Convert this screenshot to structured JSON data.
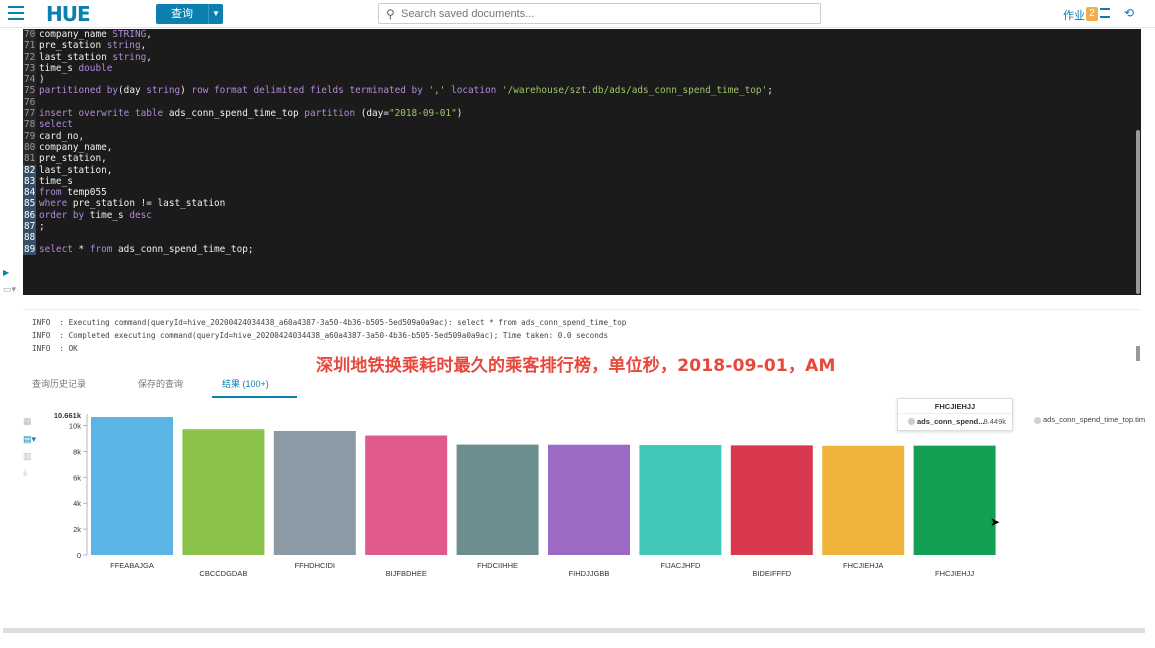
{
  "topbar": {
    "logo": "HUE",
    "query_button": "查询",
    "search_placeholder": "Search saved documents...",
    "jobs_label": "作业",
    "jobs_count": "2"
  },
  "editor": {
    "lines": [
      {
        "n": "70",
        "html": "company_name <span class='ty'>STRING</span>,"
      },
      {
        "n": "71",
        "html": "pre_station <span class='ty'>string</span>,"
      },
      {
        "n": "72",
        "html": "last_station <span class='ty'>string</span>,"
      },
      {
        "n": "73",
        "html": "time_s <span class='ty'>double</span>"
      },
      {
        "n": "74",
        "html": ")"
      },
      {
        "n": "75",
        "html": "<span class='kw'>partitioned by</span>(day <span class='ty'>string</span>) <span class='kw'>row format delimited fields terminated by</span> <span class='str'>','</span> <span class='kw'>location</span> <span class='str'>'/warehouse/szt.db/ads/ads_conn_spend_time_top'</span>;"
      },
      {
        "n": "76",
        "html": ""
      },
      {
        "n": "77",
        "html": "<span class='kw'>insert overwrite table</span> ads_conn_spend_time_top <span class='kw'>partition</span> (day=<span class='str'>\"2018-09-01\"</span>)"
      },
      {
        "n": "78",
        "html": "<span class='kw'>select</span>"
      },
      {
        "n": "79",
        "html": "card_no,"
      },
      {
        "n": "80",
        "html": "company_name,"
      },
      {
        "n": "81",
        "html": "pre_station,"
      },
      {
        "n": "82",
        "html": "last_station,"
      },
      {
        "n": "83",
        "html": "time_s"
      },
      {
        "n": "84",
        "html": "<span class='kw'>from</span> temp055"
      },
      {
        "n": "85",
        "html": "<span class='kw'>where</span> pre_station != last_station"
      },
      {
        "n": "86",
        "html": "<span class='kw'>order by</span> time_s <span class='kw'>desc</span>"
      },
      {
        "n": "87",
        "html": ";"
      },
      {
        "n": "88",
        "html": ""
      },
      {
        "n": "89",
        "html": "<span class='kw'>select</span> * <span class='kw'>from</span> ads_conn_spend_time_top;"
      }
    ],
    "highlighted": [
      "82",
      "83",
      "84",
      "85",
      "86",
      "87",
      "88",
      "89"
    ]
  },
  "log": {
    "lines": [
      "INFO  : Executing command(queryId=hive_20200424034438_a60a4387-3a50-4b36-b505-5ed509a0a9ac): select * from ads_conn_spend_time_top",
      "INFO  : Completed executing command(queryId=hive_20200424034438_a60a4387-3a50-4b36-b505-5ed509a0a9ac); Time taken: 0.0 seconds",
      "INFO  : OK"
    ]
  },
  "overlay_caption": "深圳地铁换乘耗时最久的乘客排行榜，单位秒，2018-09-01，AM",
  "tabs": [
    {
      "label": "查询历史记录",
      "active": false
    },
    {
      "label": "保存的查询",
      "active": false
    },
    {
      "label": "结果 (100+)",
      "active": true
    }
  ],
  "tooltip": {
    "title": "FHCJIEHJJ",
    "series": "ads_conn_spend...",
    "value": "8.449k"
  },
  "legend": "ads_conn_spend_time_top.tim",
  "chart_data": {
    "type": "bar",
    "categories": [
      "FFEABAJGA",
      "CBCCDGDAB",
      "FFHDHCIDI",
      "BIJFBDHEE",
      "FHDCIIHHE",
      "FIHDJJGBB",
      "FIJACJHFD",
      "BIDEIFFFD",
      "FHCJIEHJA",
      "FHCJIEHJJ"
    ],
    "values": [
      10661,
      9720,
      9580,
      9230,
      8530,
      8520,
      8500,
      8470,
      8440,
      8449
    ],
    "colors": [
      "#5ab4e5",
      "#8bc34a",
      "#8c9aa5",
      "#e0598b",
      "#6c8e8e",
      "#9c6ac4",
      "#43c7b8",
      "#d9394e",
      "#f0b43c",
      "#13a055"
    ],
    "yticks": [
      "0",
      "2k",
      "4k",
      "6k",
      "8k",
      "10k"
    ],
    "ymax_label": "10.661k",
    "ylim": [
      0,
      10661
    ]
  }
}
